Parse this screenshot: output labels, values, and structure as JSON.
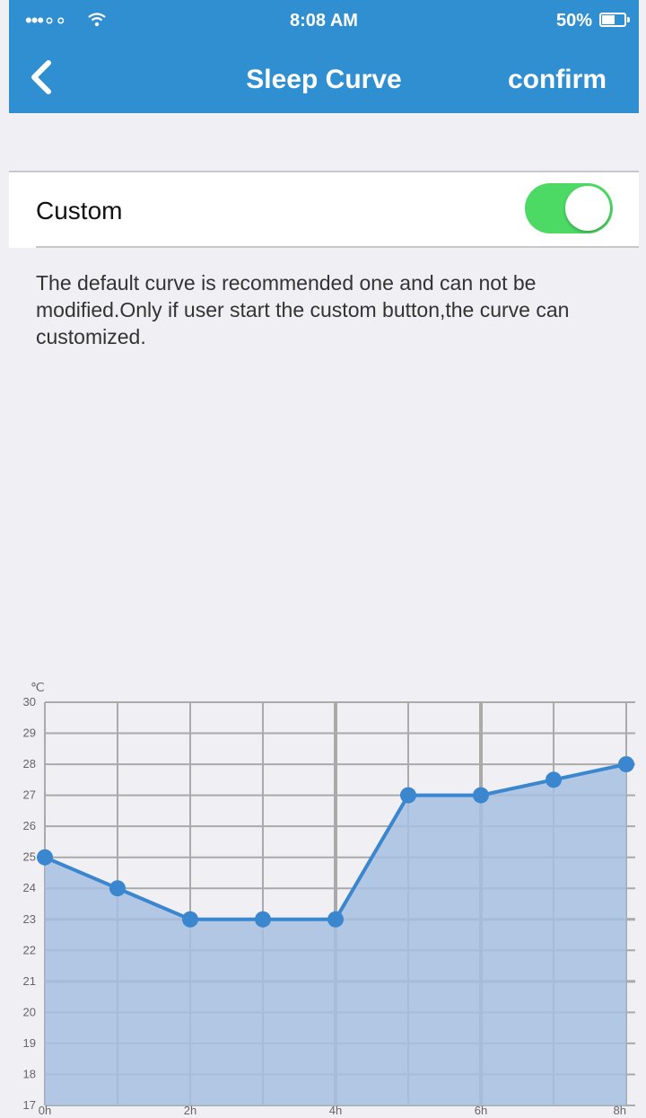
{
  "status_bar": {
    "signal": "•••∘∘",
    "time": "8:08 AM",
    "battery": "50%"
  },
  "nav": {
    "title": "Sleep Curve",
    "confirm_label": "confirm"
  },
  "settings": {
    "custom_label": "Custom",
    "custom_enabled": true
  },
  "description": "The default curve is recommended one and can not be modified.Only if user start the custom button,the curve can customized.",
  "chart_data": {
    "type": "area",
    "ylabel": "℃",
    "ylim": [
      17,
      30
    ],
    "yticks": [
      "17",
      "18",
      "19",
      "20",
      "21",
      "22",
      "23",
      "24",
      "25",
      "26",
      "27",
      "28",
      "29",
      "30"
    ],
    "x": [
      0,
      1,
      2,
      3,
      4,
      5,
      6,
      7,
      8
    ],
    "xticks": [
      {
        "x": 0,
        "label": "0h"
      },
      {
        "x": 2,
        "label": "2h"
      },
      {
        "x": 4,
        "label": "4h"
      },
      {
        "x": 6,
        "label": "6h"
      },
      {
        "x": 8,
        "label": "8h"
      }
    ],
    "values": [
      25,
      24,
      23,
      23,
      23,
      27,
      27,
      27.5,
      28
    ],
    "line_color": "#3a86cf",
    "fill_color": "#a6bfe0",
    "grid": true
  },
  "colors": {
    "accent": "#2f8fd0",
    "toggle_on": "#4cd964",
    "background": "#efeff4"
  }
}
